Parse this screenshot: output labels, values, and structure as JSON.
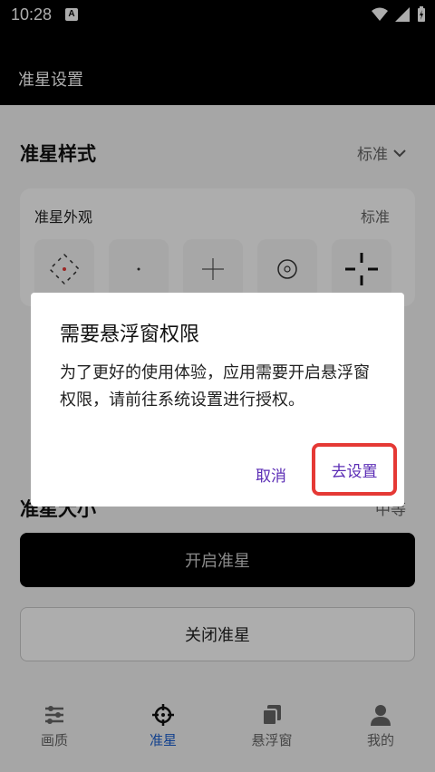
{
  "status_bar": {
    "time": "10:28",
    "notif_glyph": "A"
  },
  "app_bar": {
    "title": "准星设置"
  },
  "crosshair_style": {
    "title": "准星样式",
    "selected": "标准"
  },
  "appearance": {
    "label": "准星外观",
    "value": "标准",
    "options": [
      {
        "icon": "dotted-diamond-crosshair-icon"
      },
      {
        "icon": "dot-crosshair-icon"
      },
      {
        "icon": "cross-crosshair-icon"
      },
      {
        "icon": "circle-dot-crosshair-icon"
      },
      {
        "icon": "gap-cross-crosshair-icon"
      }
    ]
  },
  "crosshair_size": {
    "title": "准星大小",
    "selected": "中等"
  },
  "actions": {
    "open_label": "开启准星",
    "close_label": "关闭准星"
  },
  "bottom_nav": [
    {
      "label": "画质",
      "icon": "sliders-icon",
      "active": false
    },
    {
      "label": "准星",
      "icon": "crosshair-icon",
      "active": true
    },
    {
      "label": "悬浮窗",
      "icon": "floating-window-icon",
      "active": false
    },
    {
      "label": "我的",
      "icon": "person-icon",
      "active": false
    }
  ],
  "dialog": {
    "title": "需要悬浮窗权限",
    "message": "为了更好的使用体验，应用需要开启悬浮窗权限，请前往系统设置进行授权。",
    "cancel_label": "取消",
    "confirm_label": "去设置"
  },
  "colors": {
    "accent": "#5b2db5",
    "nav_active": "#1a5fd0",
    "highlight": "#e53935"
  }
}
